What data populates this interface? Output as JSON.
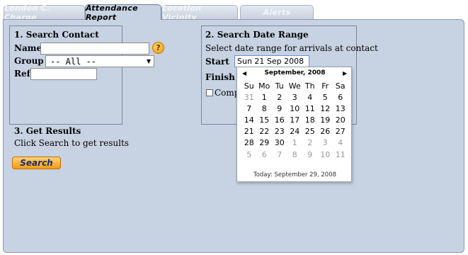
{
  "tabs": [
    {
      "label": "London C. Charge"
    },
    {
      "label": "Attendance Report"
    },
    {
      "label": "Location Vicinity"
    },
    {
      "label": "Alerts"
    }
  ],
  "search_contact": {
    "title": "1. Search Contact",
    "name_label": "Name",
    "name_value": "",
    "help_glyph": "?",
    "group_label": "Group",
    "group_value": "-- All --",
    "ref_label": "Ref",
    "ref_value": ""
  },
  "date_range": {
    "title": "2. Search Date Range",
    "description": "Select date range for arrivals at contact",
    "start_label": "Start",
    "start_value": "Sun 21 Sep 2008",
    "finish_label": "Finish",
    "checkbox_label_partial": "Comp"
  },
  "get_results": {
    "title": "3. Get Results",
    "description": "Click Search to get results",
    "search_label": "Search"
  },
  "calendar": {
    "month_title": "September, 2008",
    "prev_glyph": "◀",
    "next_glyph": "▶",
    "weekdays": [
      "Su",
      "Mo",
      "Tu",
      "We",
      "Th",
      "Fr",
      "Sa"
    ],
    "weeks": [
      [
        {
          "d": "31",
          "out": true
        },
        {
          "d": "1"
        },
        {
          "d": "2"
        },
        {
          "d": "3"
        },
        {
          "d": "4"
        },
        {
          "d": "5"
        },
        {
          "d": "6"
        }
      ],
      [
        {
          "d": "7"
        },
        {
          "d": "8"
        },
        {
          "d": "9"
        },
        {
          "d": "10"
        },
        {
          "d": "11"
        },
        {
          "d": "12"
        },
        {
          "d": "13"
        }
      ],
      [
        {
          "d": "14"
        },
        {
          "d": "15"
        },
        {
          "d": "16"
        },
        {
          "d": "17"
        },
        {
          "d": "18"
        },
        {
          "d": "19"
        },
        {
          "d": "20"
        }
      ],
      [
        {
          "d": "21"
        },
        {
          "d": "22"
        },
        {
          "d": "23"
        },
        {
          "d": "24"
        },
        {
          "d": "25"
        },
        {
          "d": "26"
        },
        {
          "d": "27"
        }
      ],
      [
        {
          "d": "28"
        },
        {
          "d": "29"
        },
        {
          "d": "30"
        },
        {
          "d": "1",
          "out": true
        },
        {
          "d": "2",
          "out": true
        },
        {
          "d": "3",
          "out": true
        },
        {
          "d": "4",
          "out": true
        }
      ],
      [
        {
          "d": "5",
          "out": true
        },
        {
          "d": "6",
          "out": true
        },
        {
          "d": "7",
          "out": true
        },
        {
          "d": "8",
          "out": true
        },
        {
          "d": "9",
          "out": true
        },
        {
          "d": "10",
          "out": true
        },
        {
          "d": "11",
          "out": true
        }
      ]
    ],
    "today_text": "Today: September 29, 2008"
  },
  "colors": {
    "panel_bg": "#c7d2e2",
    "accent_button": "#f59a12"
  }
}
